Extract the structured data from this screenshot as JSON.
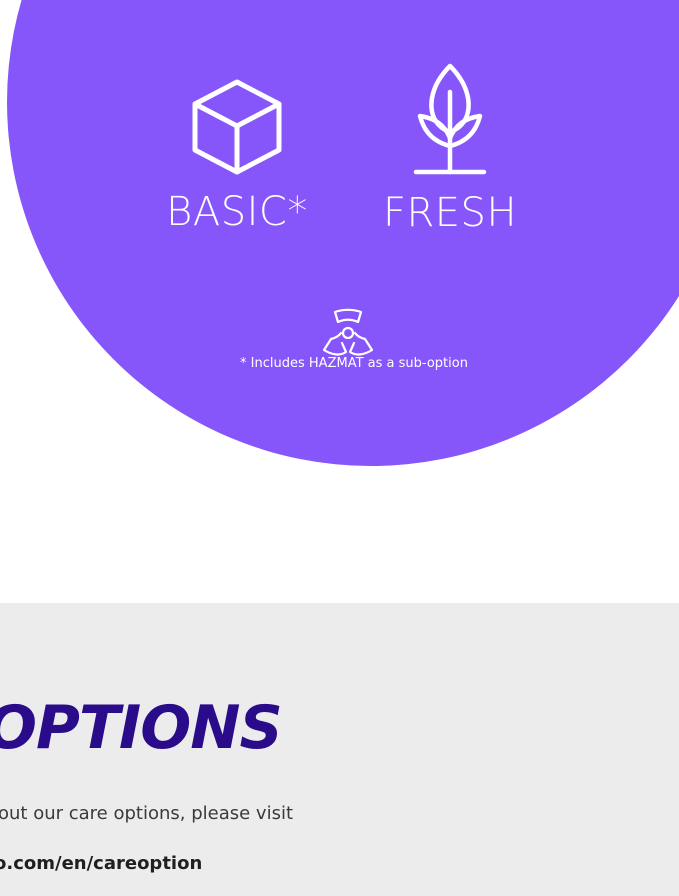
{
  "options": [
    {
      "icon": "box-icon",
      "label": "BASIC*"
    },
    {
      "icon": "sprout-icon",
      "label": "FRESH"
    }
  ],
  "hazmat": {
    "icon": "radiation-icon",
    "footnote": "* Includes HAZMAT as a sub-option"
  },
  "info": {
    "heading": "OPTIONS",
    "text": "out our care options, please visit",
    "link": "o.com/en/careoption"
  },
  "colors": {
    "circle": "#8656fa",
    "section_background": "#ececec",
    "heading": "#2a0b8a"
  }
}
